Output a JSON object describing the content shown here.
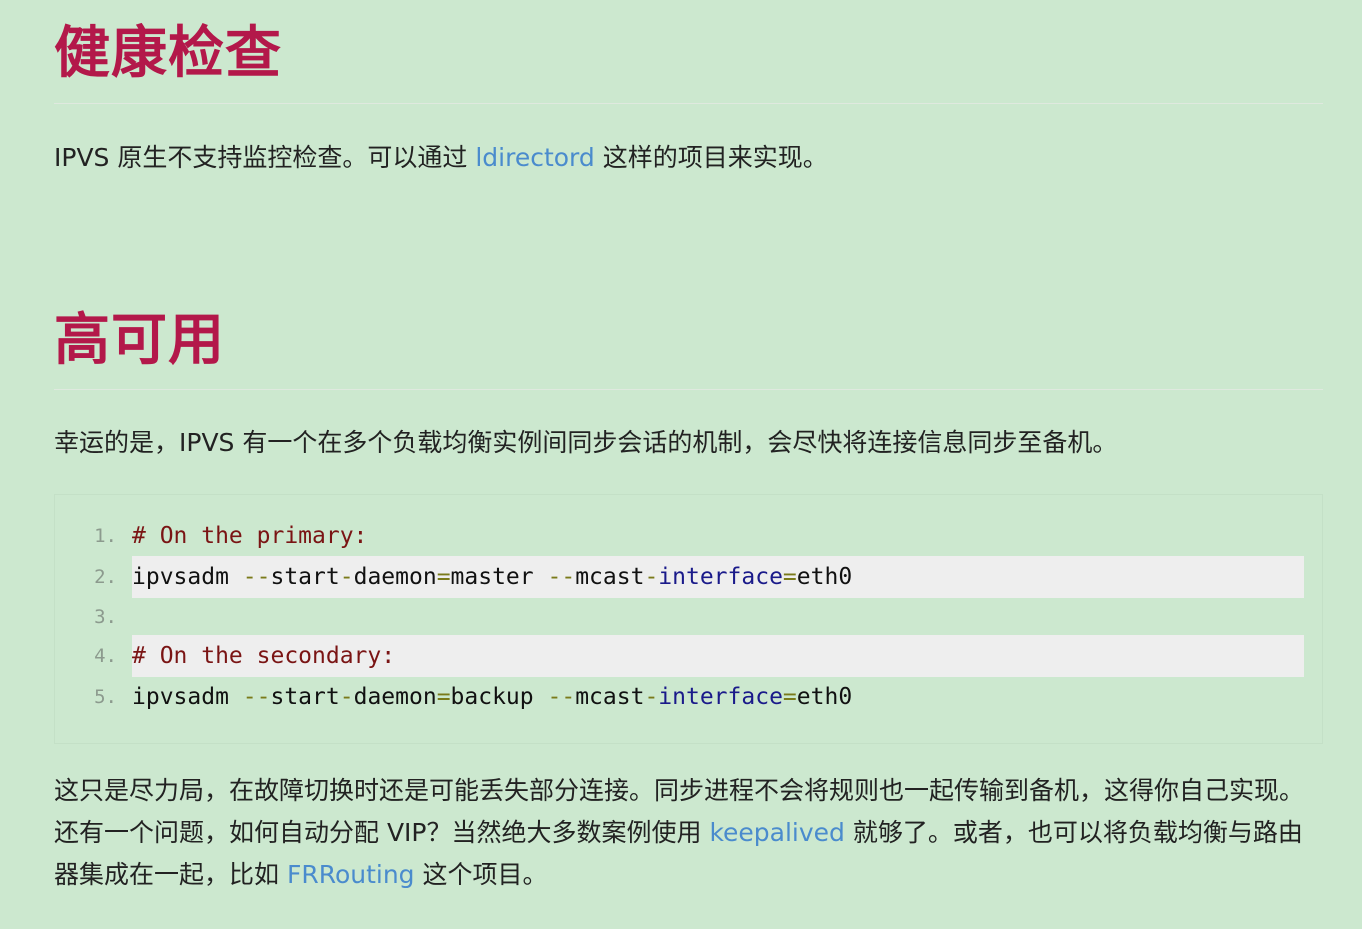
{
  "section1": {
    "heading": "健康检查",
    "text_before": "IPVS 原生不支持监控检查。可以通过 ",
    "link": "ldirectord",
    "text_after": " 这样的项目来实现。"
  },
  "section2": {
    "heading": "高可用",
    "intro": "幸运的是，IPVS 有一个在多个负载均衡实例间同步会话的机制，会尽快将连接信息同步至备机。",
    "code": {
      "lines": [
        {
          "num": "1.",
          "tokens": [
            {
              "t": "# On the primary:",
              "c": "comment"
            }
          ]
        },
        {
          "num": "2.",
          "tokens": [
            {
              "t": "ipvsadm ",
              "c": "plain"
            },
            {
              "t": "--",
              "c": "op"
            },
            {
              "t": "start",
              "c": "plain"
            },
            {
              "t": "-",
              "c": "op"
            },
            {
              "t": "daemon",
              "c": "plain"
            },
            {
              "t": "=",
              "c": "op"
            },
            {
              "t": "master ",
              "c": "plain"
            },
            {
              "t": "--",
              "c": "op"
            },
            {
              "t": "mcast",
              "c": "plain"
            },
            {
              "t": "-",
              "c": "op"
            },
            {
              "t": "interface",
              "c": "kw"
            },
            {
              "t": "=",
              "c": "op"
            },
            {
              "t": "eth0",
              "c": "plain"
            }
          ]
        },
        {
          "num": "3.",
          "tokens": []
        },
        {
          "num": "4.",
          "tokens": [
            {
              "t": "# On the secondary:",
              "c": "comment"
            }
          ]
        },
        {
          "num": "5.",
          "tokens": [
            {
              "t": "ipvsadm ",
              "c": "plain"
            },
            {
              "t": "--",
              "c": "op"
            },
            {
              "t": "start",
              "c": "plain"
            },
            {
              "t": "-",
              "c": "op"
            },
            {
              "t": "daemon",
              "c": "plain"
            },
            {
              "t": "=",
              "c": "op"
            },
            {
              "t": "backup ",
              "c": "plain"
            },
            {
              "t": "--",
              "c": "op"
            },
            {
              "t": "mcast",
              "c": "plain"
            },
            {
              "t": "-",
              "c": "op"
            },
            {
              "t": "interface",
              "c": "kw"
            },
            {
              "t": "=",
              "c": "op"
            },
            {
              "t": "eth0",
              "c": "plain"
            }
          ]
        }
      ]
    },
    "outro": {
      "part1": "这只是尽力局，在故障切换时还是可能丢失部分连接。同步进程不会将规则也一起传输到备机，这得你自己实现。还有一个问题，如何自动分配 VIP？当然绝大多数案例使用 ",
      "link1": "keepalived",
      "part2": " 就够了。或者，也可以将负载均衡与路由器集成在一起，比如 ",
      "link2": "FRRouting",
      "part3": " 这个项目。"
    }
  },
  "colors": {
    "background": "#cce8cf",
    "heading": "#b3184a",
    "link": "#4a8bcd",
    "code_highlight": "#eeeeee"
  }
}
